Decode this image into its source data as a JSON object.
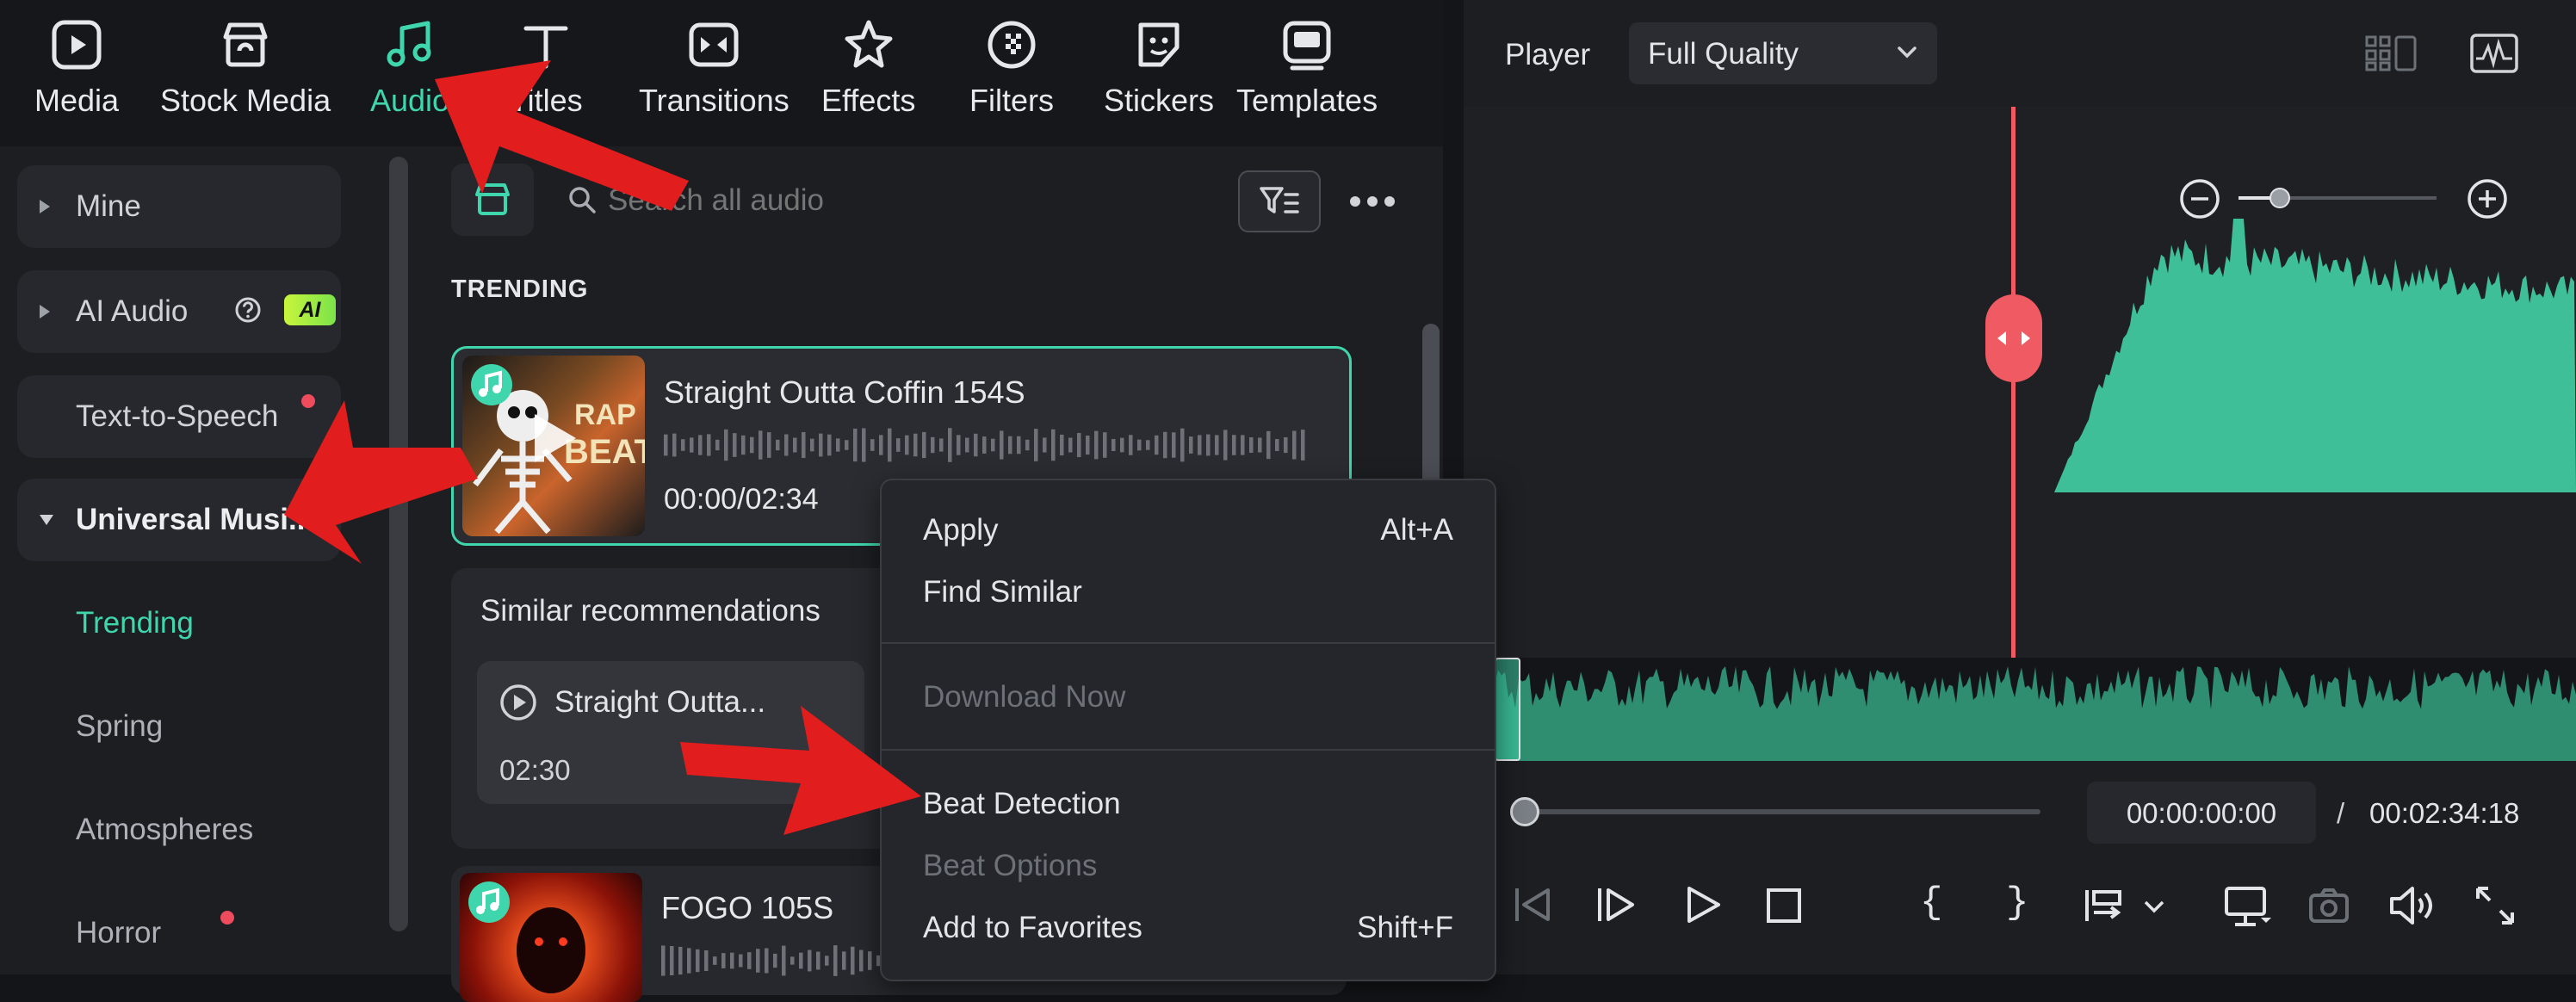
{
  "nav": {
    "items": [
      {
        "label": "Media",
        "icon": "media-icon"
      },
      {
        "label": "Stock Media",
        "icon": "stock-media-icon"
      },
      {
        "label": "Audio",
        "icon": "music-note-icon",
        "active": true
      },
      {
        "label": "Titles",
        "icon": "titles-icon"
      },
      {
        "label": "Transitions",
        "icon": "transitions-icon"
      },
      {
        "label": "Effects",
        "icon": "effects-icon"
      },
      {
        "label": "Filters",
        "icon": "filters-icon"
      },
      {
        "label": "Stickers",
        "icon": "stickers-icon"
      },
      {
        "label": "Templates",
        "icon": "templates-icon"
      }
    ]
  },
  "sidebar": {
    "categories": [
      {
        "label": "Mine",
        "expanded": false
      },
      {
        "label": "AI Audio",
        "badge": "AI",
        "expanded": false
      },
      {
        "label": "Text-to-Speech",
        "has_dot": true
      },
      {
        "label": "Universal Musi...",
        "expanded": true
      }
    ],
    "sub_items": [
      {
        "label": "Trending",
        "active": true
      },
      {
        "label": "Spring"
      },
      {
        "label": "Atmospheres"
      },
      {
        "label": "Horror",
        "has_dot": true
      }
    ]
  },
  "search": {
    "placeholder": "Search all audio"
  },
  "content": {
    "section_title": "TRENDING",
    "tracks": [
      {
        "title": "Straight Outta Coffin 154S",
        "time": "00:00/02:34",
        "selected": true
      },
      {
        "title": "FOGO 105S"
      }
    ],
    "similar": {
      "title": "Similar recommendations",
      "item_title": "Straight Outta...",
      "item_duration": "02:30"
    }
  },
  "player": {
    "label": "Player",
    "quality": "Full Quality",
    "current_time": "00:00:00:00",
    "separator": "/",
    "total_time": "00:02:34:18"
  },
  "context_menu": {
    "items": [
      {
        "label": "Apply",
        "shortcut": "Alt+A"
      },
      {
        "label": "Find Similar"
      },
      {
        "label": "Download Now",
        "disabled": true
      },
      {
        "label": "Beat Detection"
      },
      {
        "label": "Beat Options",
        "disabled": true
      },
      {
        "label": "Add to Favorites",
        "shortcut": "Shift+F"
      }
    ]
  },
  "colors": {
    "accent": "#3fd6ad",
    "playhead": "#f05a62",
    "annotation_arrow": "#e21d1d"
  }
}
